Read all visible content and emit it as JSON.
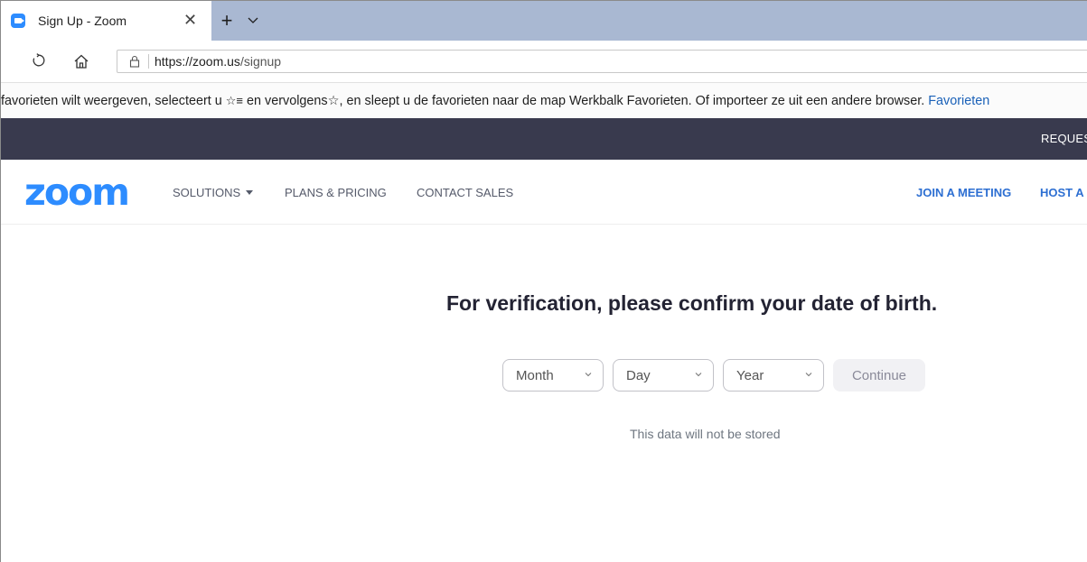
{
  "browser": {
    "tab_title": "Sign Up - Zoom",
    "tab_close_glyph": "✕",
    "new_tab_glyph": "+",
    "url_host": "https://zoom.us",
    "url_path": "/signup"
  },
  "favorites_bar": {
    "text_before_star": "favorieten wilt weergeven, selecteert u",
    "star_glyph_1": "☆≡",
    "text_middle": "en vervolgens",
    "star_glyph_2": "☆",
    "text_after": ", en sleept u de favorieten naar de map Werkbalk Favorieten. Of importeer ze uit een andere browser.",
    "link": "Favorieten"
  },
  "zoom_topbar": {
    "request": "REQUEST"
  },
  "zoom_nav": {
    "logo": "zoom",
    "solutions": "SOLUTIONS",
    "plans": "PLANS & PRICING",
    "sales": "CONTACT SALES",
    "join": "JOIN A MEETING",
    "host": "HOST A M"
  },
  "main": {
    "heading": "For verification, please confirm your date of birth.",
    "month": "Month",
    "day": "Day",
    "year": "Year",
    "continue": "Continue",
    "note": "This data will not be stored"
  },
  "colors": {
    "zoom_blue": "#2d8cff",
    "topbar": "#393a4e",
    "tabstrip": "#a9b8d2"
  }
}
